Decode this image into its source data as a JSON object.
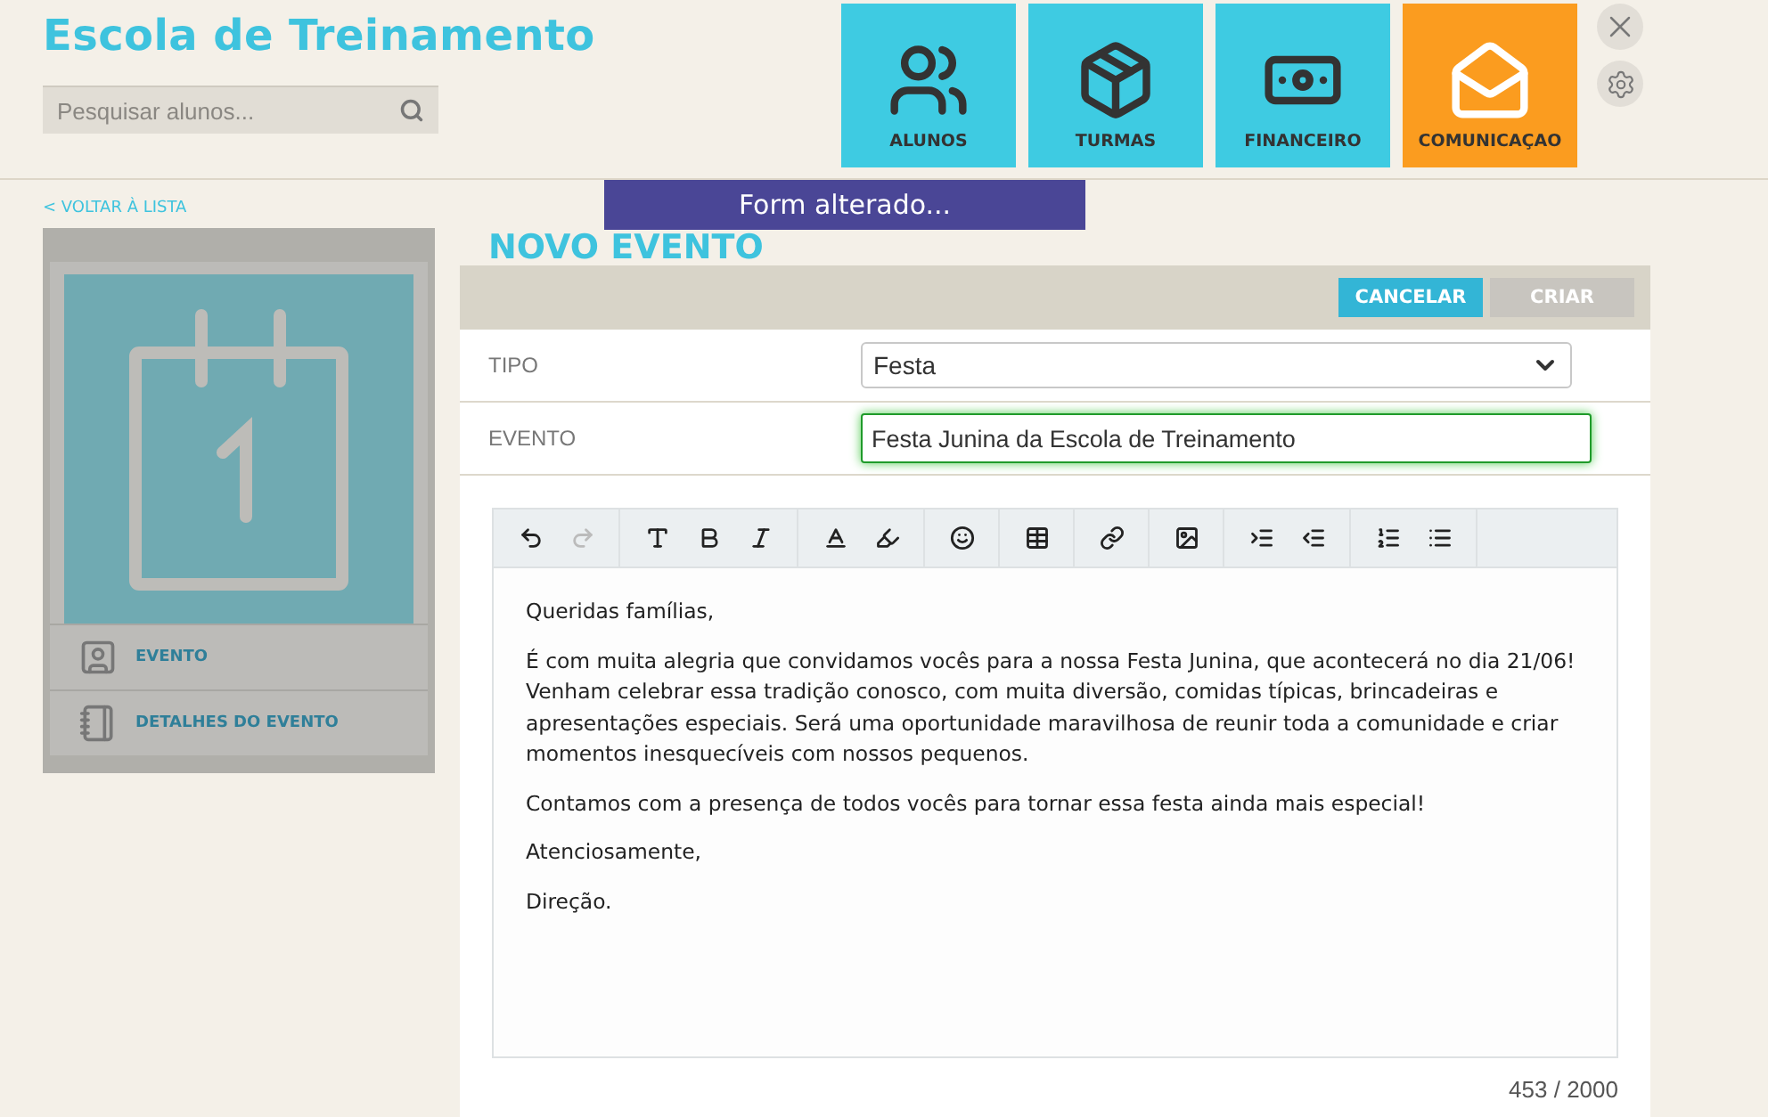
{
  "header": {
    "title": "Escola de Treinamento",
    "search": {
      "placeholder": "Pesquisar alunos..."
    }
  },
  "nav_tiles": [
    {
      "kind": "students",
      "label": "ALUNOS",
      "selected": false
    },
    {
      "kind": "classes",
      "label": "TURMAS",
      "selected": false
    },
    {
      "kind": "finance",
      "label": "FINANCEIRO",
      "selected": false
    },
    {
      "kind": "communication",
      "label": "COMUNICAÇAO",
      "selected": true
    }
  ],
  "back_link": "< VOLTAR À LISTA",
  "sidebar": {
    "items": [
      {
        "kind": "event",
        "label": "EVENTO"
      },
      {
        "kind": "details",
        "label": "DETALHES DO EVENTO"
      }
    ]
  },
  "toast": "Form alterado...",
  "page_title": "NOVO EVENTO",
  "actions": [
    {
      "kind": "cancel",
      "label": "CANCELAR",
      "disabled": false
    },
    {
      "kind": "create",
      "label": "CRIAR",
      "disabled": true
    }
  ],
  "form": {
    "fields": [
      {
        "kind": "select",
        "label": "TIPO",
        "value": "Festa"
      },
      {
        "kind": "text",
        "label": "EVENTO",
        "value": "Festa Junina da Escola de Treinamento",
        "focused": true
      }
    ]
  },
  "editor": {
    "toolbar": [
      [
        {
          "kind": "undo",
          "disabled": false
        },
        {
          "kind": "redo",
          "disabled": true
        }
      ],
      [
        {
          "kind": "text-size",
          "disabled": false
        },
        {
          "kind": "bold",
          "disabled": false
        },
        {
          "kind": "italic",
          "disabled": false
        }
      ],
      [
        {
          "kind": "font-color",
          "disabled": false
        },
        {
          "kind": "highlight",
          "disabled": false
        }
      ],
      [
        {
          "kind": "emoji",
          "disabled": false
        }
      ],
      [
        {
          "kind": "table",
          "disabled": false
        }
      ],
      [
        {
          "kind": "link",
          "disabled": false
        }
      ],
      [
        {
          "kind": "image",
          "disabled": false
        }
      ],
      [
        {
          "kind": "indent",
          "disabled": false
        },
        {
          "kind": "outdent",
          "disabled": false
        }
      ],
      [
        {
          "kind": "ordered-list",
          "disabled": false
        },
        {
          "kind": "bullet-list",
          "disabled": false
        }
      ]
    ],
    "paragraphs": [
      "Queridas famílias,",
      "É com muita alegria que convidamos vocês para a nossa Festa Junina, que acontecerá no dia 21/06! Venham celebrar essa tradição conosco, com muita diversão, comidas típicas, brincadeiras e apresentações especiais. Será uma oportunidade maravilhosa de reunir toda a comunidade e criar momentos inesquecíveis com nossos pequenos.",
      "Contamos com a presença de todos vocês para tornar essa festa ainda mais especial!",
      "Atenciosamente,",
      "Direção."
    ],
    "counter": "453 / 2000"
  }
}
